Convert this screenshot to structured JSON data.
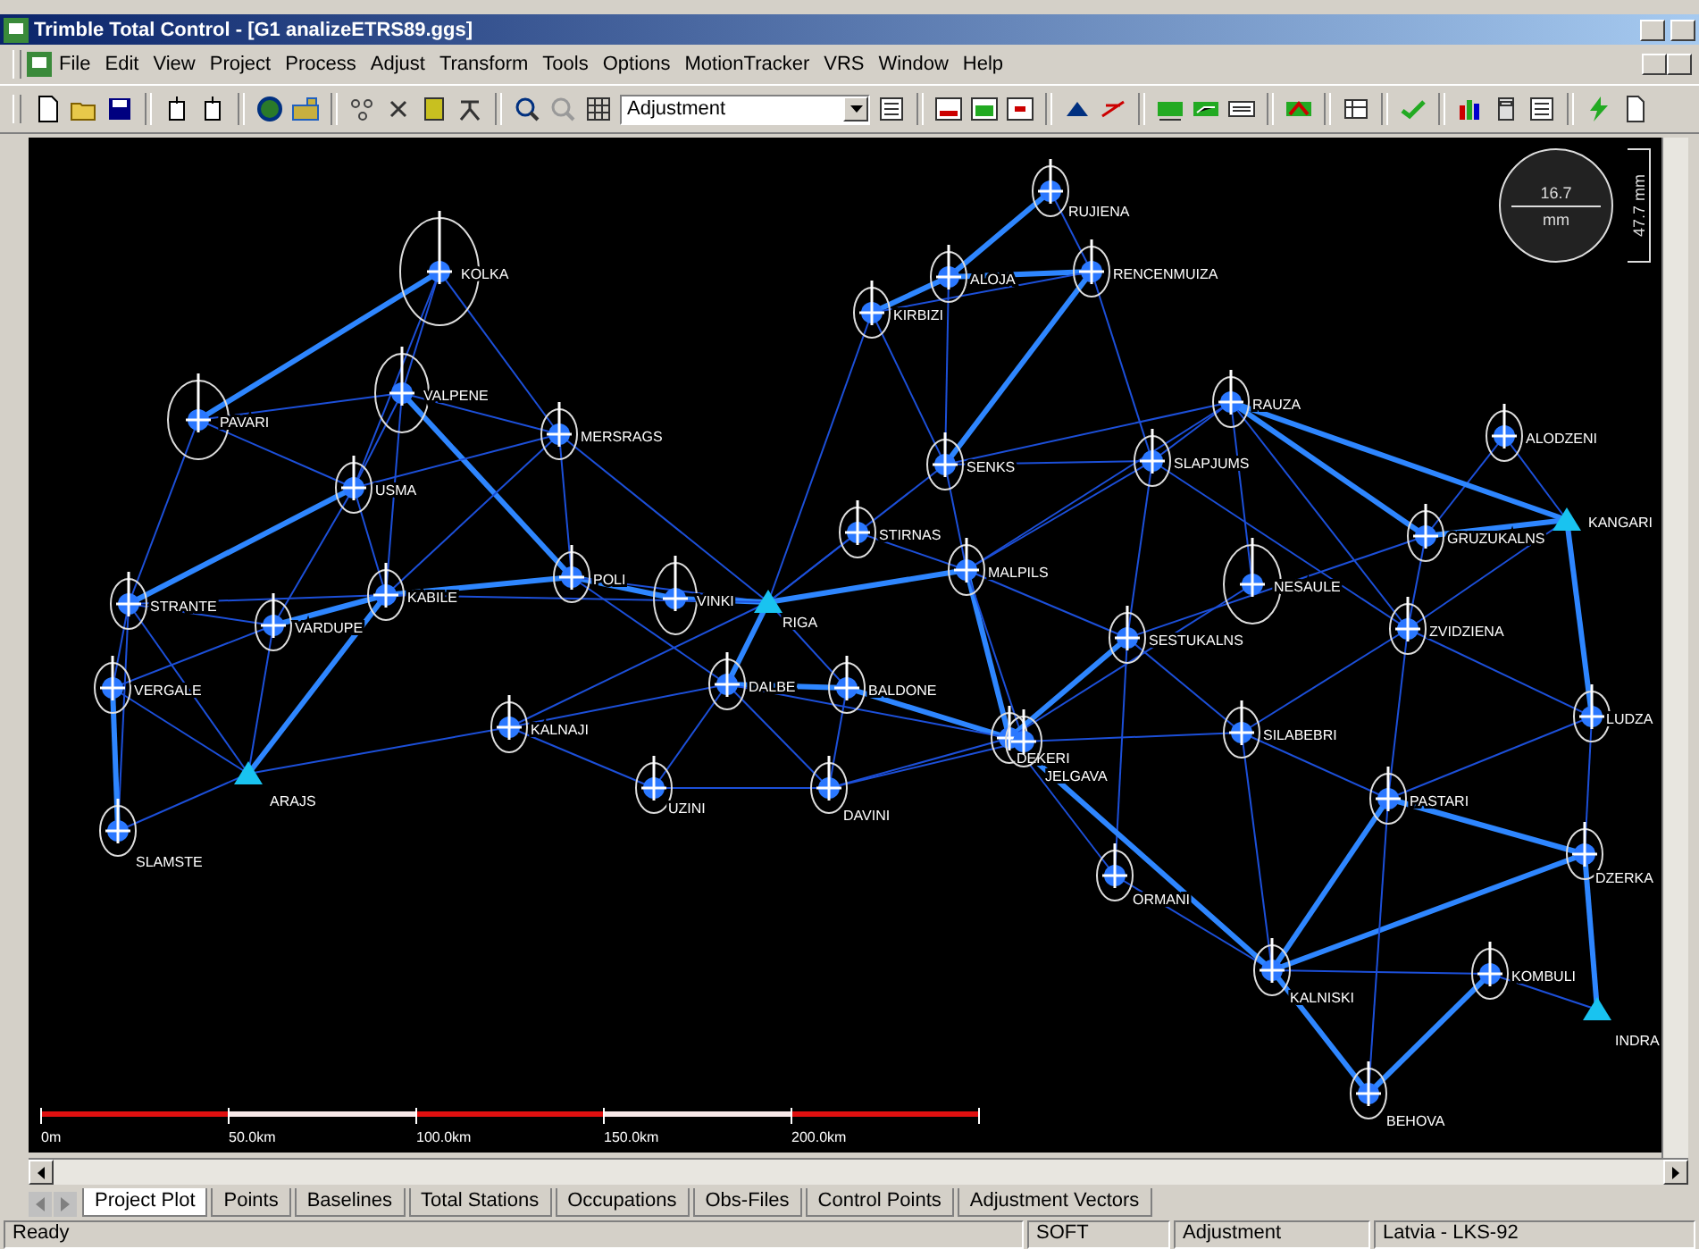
{
  "window": {
    "title": "Trimble Total Control - [G1 analizeETRS89.ggs]"
  },
  "menu": [
    "File",
    "Edit",
    "View",
    "Project",
    "Process",
    "Adjust",
    "Transform",
    "Tools",
    "Options",
    "MotionTracker",
    "VRS",
    "Window",
    "Help"
  ],
  "toolbar": {
    "view_selector": {
      "value": "Adjustment"
    }
  },
  "plot": {
    "stations": [
      {
        "name": "KOLKA",
        "kind": "point"
      },
      {
        "name": "PAVARI",
        "kind": "point"
      },
      {
        "name": "VALPENE",
        "kind": "point"
      },
      {
        "name": "MERSRAGS",
        "kind": "point"
      },
      {
        "name": "USMA",
        "kind": "point"
      },
      {
        "name": "STRANTE",
        "kind": "point"
      },
      {
        "name": "VARDUPE",
        "kind": "point"
      },
      {
        "name": "KABILE",
        "kind": "point"
      },
      {
        "name": "POLI",
        "kind": "point"
      },
      {
        "name": "VINKI",
        "kind": "point"
      },
      {
        "name": "RIGA",
        "kind": "control"
      },
      {
        "name": "VERGALE",
        "kind": "point"
      },
      {
        "name": "ARAJS",
        "kind": "control"
      },
      {
        "name": "SLAMSTE",
        "kind": "point"
      },
      {
        "name": "KALNAJI",
        "kind": "point"
      },
      {
        "name": "UZINI",
        "kind": "point"
      },
      {
        "name": "DALBE",
        "kind": "point"
      },
      {
        "name": "BALDONE",
        "kind": "point"
      },
      {
        "name": "DAVINI",
        "kind": "point"
      },
      {
        "name": "RUJIENA",
        "kind": "point"
      },
      {
        "name": "ALOJA",
        "kind": "point"
      },
      {
        "name": "RENCENMUIZA",
        "kind": "point"
      },
      {
        "name": "KIRBIZI",
        "kind": "point"
      },
      {
        "name": "SENKS",
        "kind": "point"
      },
      {
        "name": "STIRNAS",
        "kind": "point"
      },
      {
        "name": "MALPILS",
        "kind": "point"
      },
      {
        "name": "SLAPJUMS",
        "kind": "point"
      },
      {
        "name": "RAUZA",
        "kind": "point"
      },
      {
        "name": "ALODZENI",
        "kind": "point"
      },
      {
        "name": "KANGARI",
        "kind": "control"
      },
      {
        "name": "GRUZUKALNS",
        "kind": "point"
      },
      {
        "name": "NESAULE",
        "kind": "point"
      },
      {
        "name": "SESTUKALNS",
        "kind": "point"
      },
      {
        "name": "ZVIDZIENA",
        "kind": "point"
      },
      {
        "name": "DEKERI",
        "kind": "point"
      },
      {
        "name": "JELGAVA",
        "kind": "point"
      },
      {
        "name": "SILABEBRI",
        "kind": "point"
      },
      {
        "name": "LUDZA",
        "kind": "point"
      },
      {
        "name": "PASTARI",
        "kind": "point"
      },
      {
        "name": "DZERKA",
        "kind": "point"
      },
      {
        "name": "ORMANI",
        "kind": "point"
      },
      {
        "name": "KALNISKI",
        "kind": "point"
      },
      {
        "name": "KOMBULI",
        "kind": "point"
      },
      {
        "name": "INDRA",
        "kind": "control"
      },
      {
        "name": "BEHOVA",
        "kind": "point"
      }
    ],
    "scale_bar": [
      "0m",
      "50.0km",
      "100.0km",
      "150.0km",
      "200.0km"
    ],
    "legend": {
      "value": "16.7",
      "unit": "mm",
      "side": "47.7 mm"
    }
  },
  "tabs": [
    {
      "label": "Project Plot",
      "selected": true
    },
    {
      "label": "Points",
      "selected": false
    },
    {
      "label": "Baselines",
      "selected": false
    },
    {
      "label": "Total Stations",
      "selected": false
    },
    {
      "label": "Occupations",
      "selected": false
    },
    {
      "label": "Obs-Files",
      "selected": false
    },
    {
      "label": "Control Points",
      "selected": false
    },
    {
      "label": "Adjustment Vectors",
      "selected": false
    }
  ],
  "status_bar": [
    "Ready",
    "SOFT",
    "Adjustment",
    "Latvia - LKS-92"
  ]
}
